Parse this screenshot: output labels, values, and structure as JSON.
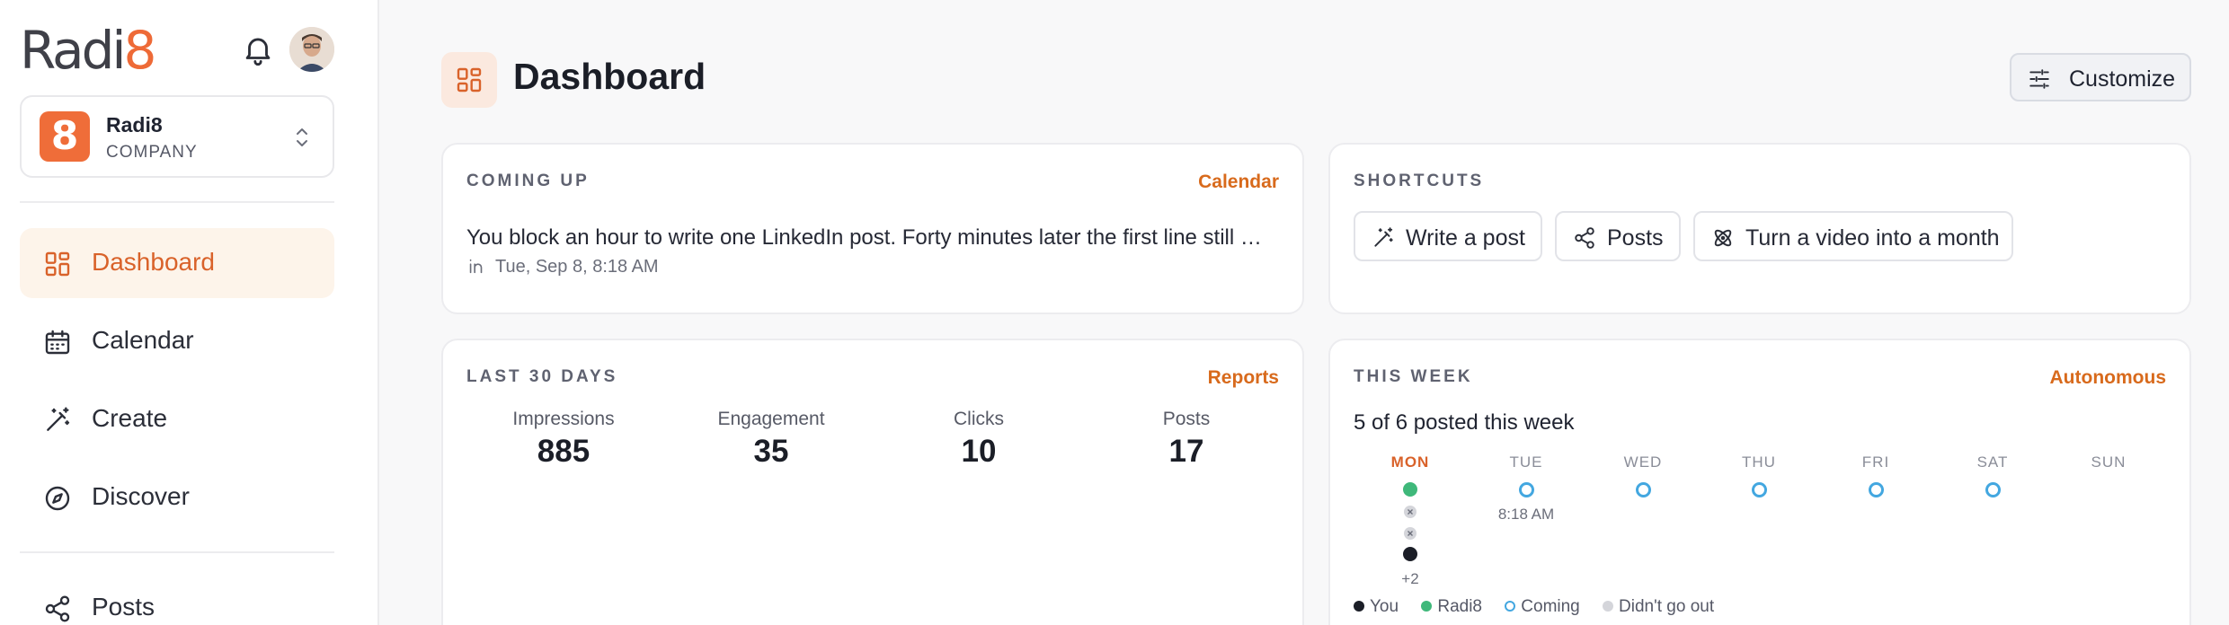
{
  "sidebar": {
    "logo": {
      "prefix": "Radi",
      "suffix": "8"
    },
    "company": {
      "badge": "8",
      "name": "Radi8",
      "type": "COMPANY"
    },
    "nav": [
      {
        "label": "Dashboard",
        "icon": "dashboard-icon",
        "active": true
      },
      {
        "label": "Calendar",
        "icon": "calendar-icon"
      },
      {
        "label": "Create",
        "icon": "magic-wand-icon"
      },
      {
        "label": "Discover",
        "icon": "compass-icon"
      },
      {
        "label": "Posts",
        "icon": "share-icon"
      }
    ]
  },
  "header": {
    "title": "Dashboard",
    "customize_label": "Customize"
  },
  "coming_up": {
    "title": "COMING UP",
    "link": "Calendar",
    "post_text": "You block an hour to write one LinkedIn post. Forty minutes later the first line still …",
    "post_meta": "Tue, Sep 8, 8:18 AM"
  },
  "shortcuts": {
    "title": "SHORTCUTS",
    "buttons": [
      {
        "label": "Write a post",
        "icon": "magic-wand-icon"
      },
      {
        "label": "Posts",
        "icon": "share-icon"
      },
      {
        "label": "Turn a video into a month",
        "icon": "atom-icon"
      }
    ]
  },
  "last30": {
    "title": "LAST 30 DAYS",
    "link": "Reports",
    "stats": [
      {
        "label": "Impressions",
        "value": "885"
      },
      {
        "label": "Engagement",
        "value": "35"
      },
      {
        "label": "Clicks",
        "value": "10"
      },
      {
        "label": "Posts",
        "value": "17"
      }
    ]
  },
  "this_week": {
    "title": "THIS WEEK",
    "link": "Autonomous",
    "summary": "5 of 6 posted this week",
    "days": [
      {
        "name": "MON",
        "today": true,
        "more": "+2"
      },
      {
        "name": "TUE",
        "time": "8:18 AM"
      },
      {
        "name": "WED"
      },
      {
        "name": "THU"
      },
      {
        "name": "FRI"
      },
      {
        "name": "SAT"
      },
      {
        "name": "SUN"
      }
    ],
    "legend": {
      "you": "You",
      "radi8": "Radi8",
      "coming": "Coming",
      "failed": "Didn't go out"
    }
  },
  "colors": {
    "accent": "#d9622a",
    "you": "#1b1e27",
    "radi8": "#3fb87a",
    "coming": "#43a7e0",
    "failed": "#9a9ca6"
  }
}
